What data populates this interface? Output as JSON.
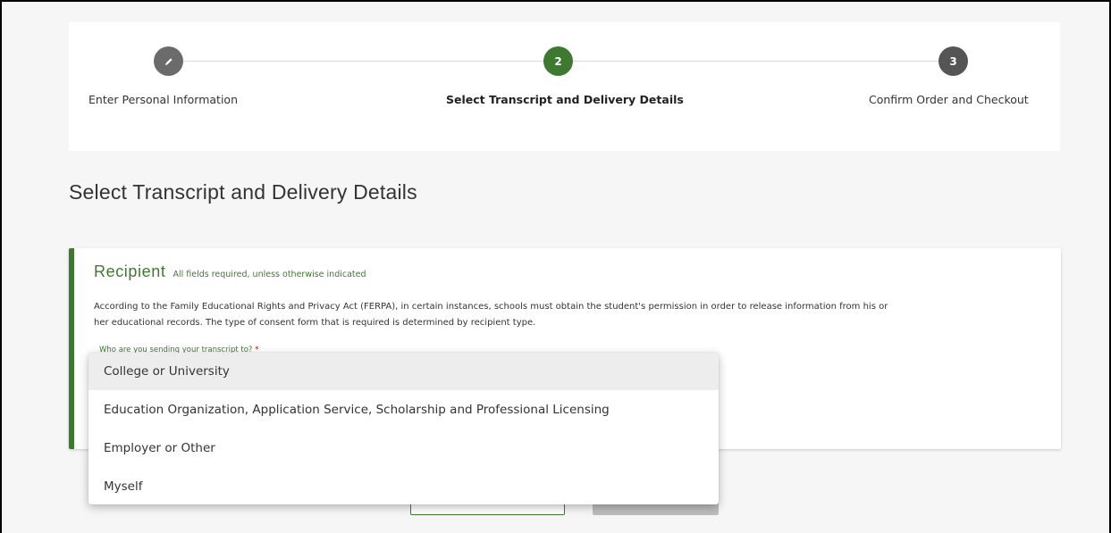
{
  "stepper": {
    "steps": [
      {
        "number": "",
        "label": "Enter Personal Information",
        "state": "completed",
        "color": "#6b6b6b"
      },
      {
        "number": "2",
        "label": "Select Transcript and Delivery Details",
        "state": "active",
        "color": "#3d7a2f"
      },
      {
        "number": "3",
        "label": "Confirm Order and Checkout",
        "state": "upcoming",
        "color": "#555555"
      }
    ]
  },
  "page": {
    "title": "Select Transcript and Delivery Details"
  },
  "recipient": {
    "heading": "Recipient",
    "note": "All fields required, unless otherwise indicated",
    "description": "According to the Family Educational Rights and Privacy Act (FERPA), in certain instances, schools must obtain the student's permission in order to release information from his or her educational records. The type of consent form that is required is determined by recipient type.",
    "field_label": "Who are you sending your transcript to?",
    "required_mark": "*"
  },
  "dropdown": {
    "options": [
      "College or University",
      "Education Organization, Application Service, Scholarship and Professional Licensing",
      "Employer or Other",
      "Myself"
    ],
    "highlighted": "College or University"
  },
  "colors": {
    "accent": "#3d7a2f",
    "completed_step": "#6b6b6b",
    "upcoming_step": "#555555"
  }
}
